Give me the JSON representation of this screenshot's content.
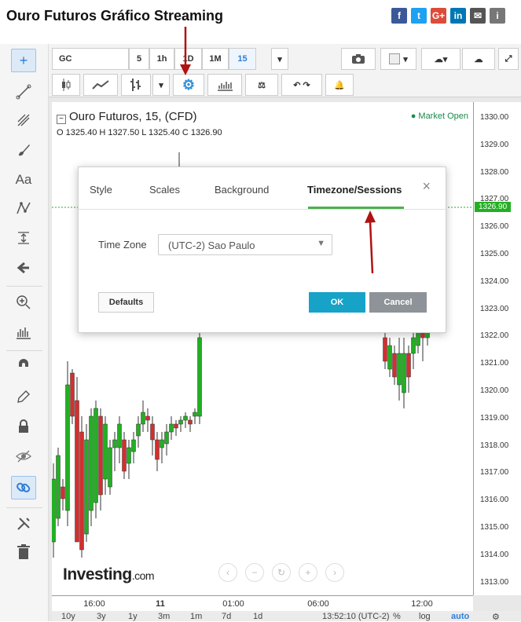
{
  "page": {
    "title": "Ouro Futuros Gráfico Streaming"
  },
  "share": [
    {
      "name": "facebook-icon",
      "glyph": "f",
      "color": "#3b5998"
    },
    {
      "name": "twitter-icon",
      "glyph": "t",
      "color": "#1da1f2"
    },
    {
      "name": "googleplus-icon",
      "glyph": "G+",
      "color": "#dd4b39"
    },
    {
      "name": "linkedin-icon",
      "glyph": "in",
      "color": "#0077b5"
    },
    {
      "name": "email-icon",
      "glyph": "✉",
      "color": "#555555"
    },
    {
      "name": "info-icon",
      "glyph": "i",
      "color": "#777777"
    }
  ],
  "toolbar": {
    "symbol": "GC",
    "intervals": [
      "5",
      "1h",
      "1D",
      "1M",
      "15"
    ],
    "active_interval": "15"
  },
  "legend": {
    "instrument": "Ouro Futuros, 15, (CFD)",
    "market_status": "Market Open",
    "ohlc": "O 1325.40  H 1327.50  L 1325.40  C 1326.90"
  },
  "price_axis": {
    "labels": [
      "1330.00",
      "1329.00",
      "1328.00",
      "1327.00",
      "1326.00",
      "1325.00",
      "1324.00",
      "1323.00",
      "1322.00",
      "1321.00",
      "1320.00",
      "1319.00",
      "1318.00",
      "1317.00",
      "1316.00",
      "1315.00",
      "1314.00",
      "1313.00"
    ],
    "current": "1326.90"
  },
  "time_axis": {
    "labels": [
      "16:00",
      "11",
      "01:00",
      "06:00",
      "12:00"
    ]
  },
  "range_bar": {
    "items": [
      "10y",
      "3y",
      "1y",
      "3m",
      "1m",
      "7d",
      "1d"
    ],
    "clock": "13:52:10 (UTC-2)",
    "percent": "%",
    "log": "log",
    "auto": "auto"
  },
  "watermark": {
    "brand": "Investing",
    "suffix": ".com"
  },
  "dialog": {
    "tabs": [
      "Style",
      "Scales",
      "Background",
      "Timezone/Sessions"
    ],
    "active_tab": "Timezone/Sessions",
    "close": "×",
    "timezone_label": "Time Zone",
    "timezone_value": "(UTC-2) Sao Paulo",
    "defaults": "Defaults",
    "ok": "OK",
    "cancel": "Cancel"
  },
  "colors": {
    "up": "#22b022",
    "down": "#d32f2f",
    "accent": "#17a2c8",
    "active_tab_underline": "#4caf50",
    "annotation_arrow": "#b01212"
  }
}
